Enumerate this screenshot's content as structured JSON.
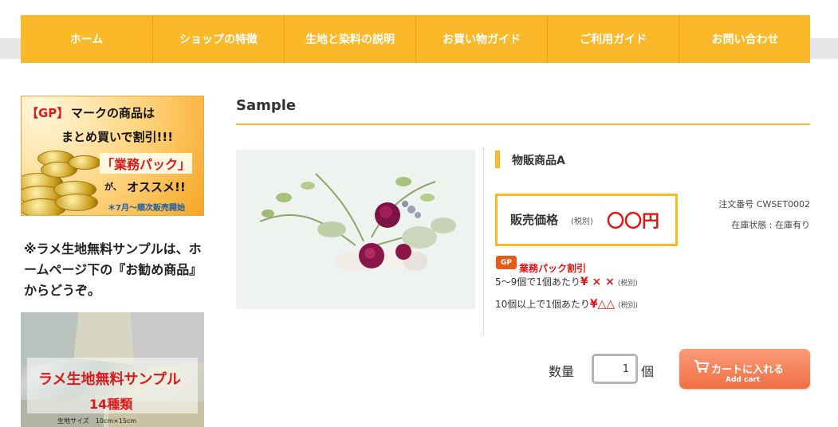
{
  "nav": {
    "items": [
      {
        "label": "ホーム"
      },
      {
        "label": "ショップの特徴"
      },
      {
        "label": "生地と染料の説明"
      },
      {
        "label": "お買い物ガイド"
      },
      {
        "label": "ご利用ガイド"
      },
      {
        "label": "お問い合わせ"
      }
    ]
  },
  "sidebar": {
    "banner1": {
      "gp": "【GP】",
      "line1": "マークの商品は",
      "line2": "まとめ買いで割引!!!",
      "line3": "「業務パック」",
      "line4_small": "が、",
      "line4": "オススメ!!",
      "note": "＊7月～順次販売開始"
    },
    "note_text": "※ラメ生地無料サンプルは、ホームページ下の『お勧め商品』からどうぞ。",
    "banner2": {
      "title": "ラメ生地無料サンプル",
      "count": "14種類",
      "size": "生地サイズ　10cm×15cm"
    }
  },
  "main": {
    "title": "Sample",
    "product": {
      "name": "物販商品A",
      "price_label": "販売価格",
      "price_tax": "(税別)",
      "price_value": "〇〇円",
      "order_no": "注文番号 CWSET0002",
      "stock": "在庫状態 : 在庫有り",
      "gp_badge": "GP",
      "gp_title": "業務パック割引",
      "tier1_text": "5～9個で1個あたり",
      "tier1_value": "¥ × ×",
      "tier1_tax": "(税別)",
      "tier2_text": "10個以上で1個あたり",
      "tier2_value": "¥△△",
      "tier2_tax": "(税別)"
    },
    "cart": {
      "qty_label": "数量",
      "qty_value": "1",
      "qty_unit": "個",
      "button_jp": "カートに入れる",
      "button_en": "Add cart"
    }
  },
  "colors": {
    "accent": "#fbb829",
    "price_red": "#e01515",
    "cart_orange": "#ef6f45"
  }
}
